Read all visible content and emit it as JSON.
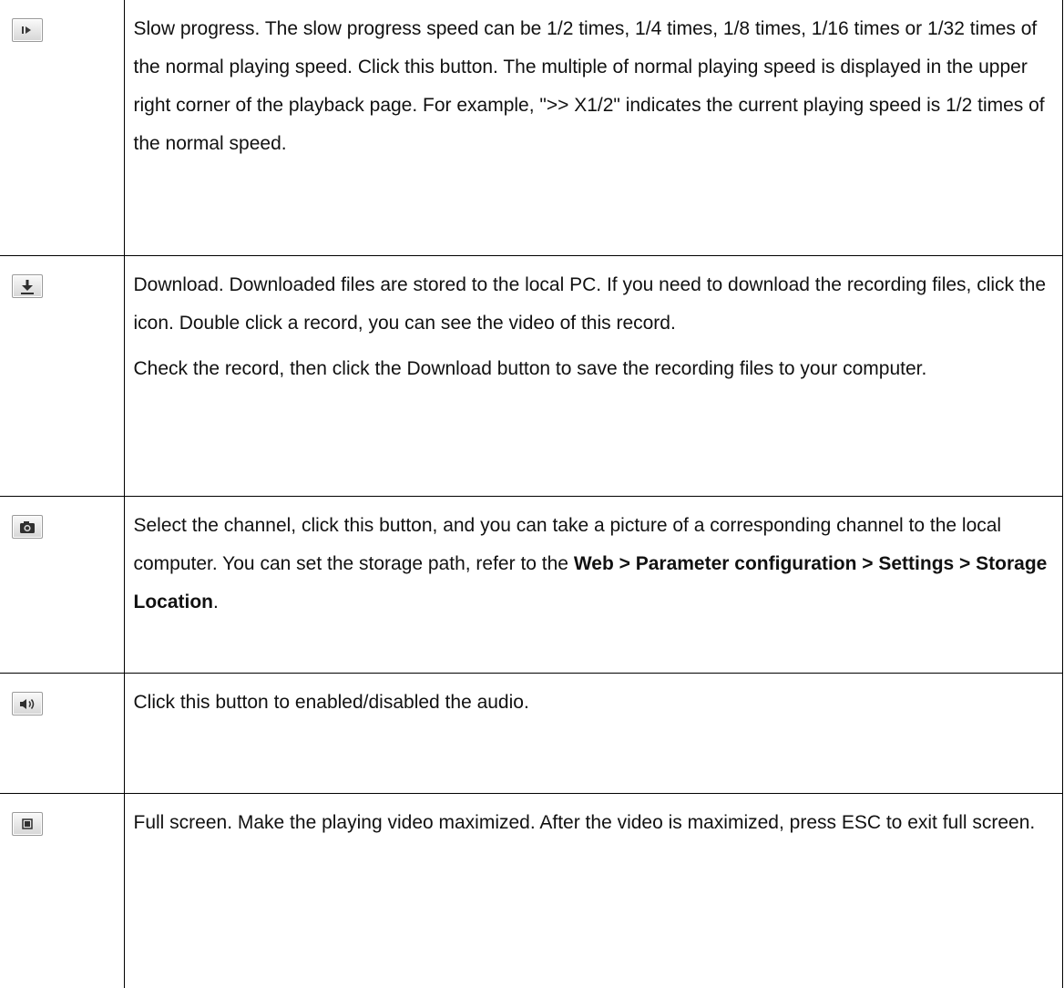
{
  "rows": [
    {
      "icon": "slow-play-icon",
      "paragraphs": [
        "Slow progress. The slow progress speed can be 1/2 times, 1/4 times, 1/8 times, 1/16 times or 1/32 times of the normal playing speed. Click this button. The multiple of normal playing speed is displayed in the upper right corner of the playback page. For example, \">> X1/2\" indicates the current playing speed is 1/2 times of the normal speed."
      ]
    },
    {
      "icon": "download-icon",
      "paragraphs": [
        "Download. Downloaded files are stored to the local PC. If you need to download the recording files, click the icon. Double click a record, you can see the video of this record.",
        "Check the record, then click the Download button to save the recording files to your computer."
      ]
    },
    {
      "icon": "camera-icon",
      "text_before": "Select the channel, click this button, and you can take a picture of a corresponding channel to the local computer. You can set the storage path, refer to the ",
      "bold_path": "Web > Parameter configuration > Settings > Storage Location",
      "text_after": "."
    },
    {
      "icon": "speaker-icon",
      "paragraphs": [
        "Click this button to enabled/disabled the audio."
      ]
    },
    {
      "icon": "fullscreen-icon",
      "paragraphs": [
        "Full screen. Make the playing video maximized. After the video is maximized, press ESC to exit full screen."
      ]
    }
  ]
}
